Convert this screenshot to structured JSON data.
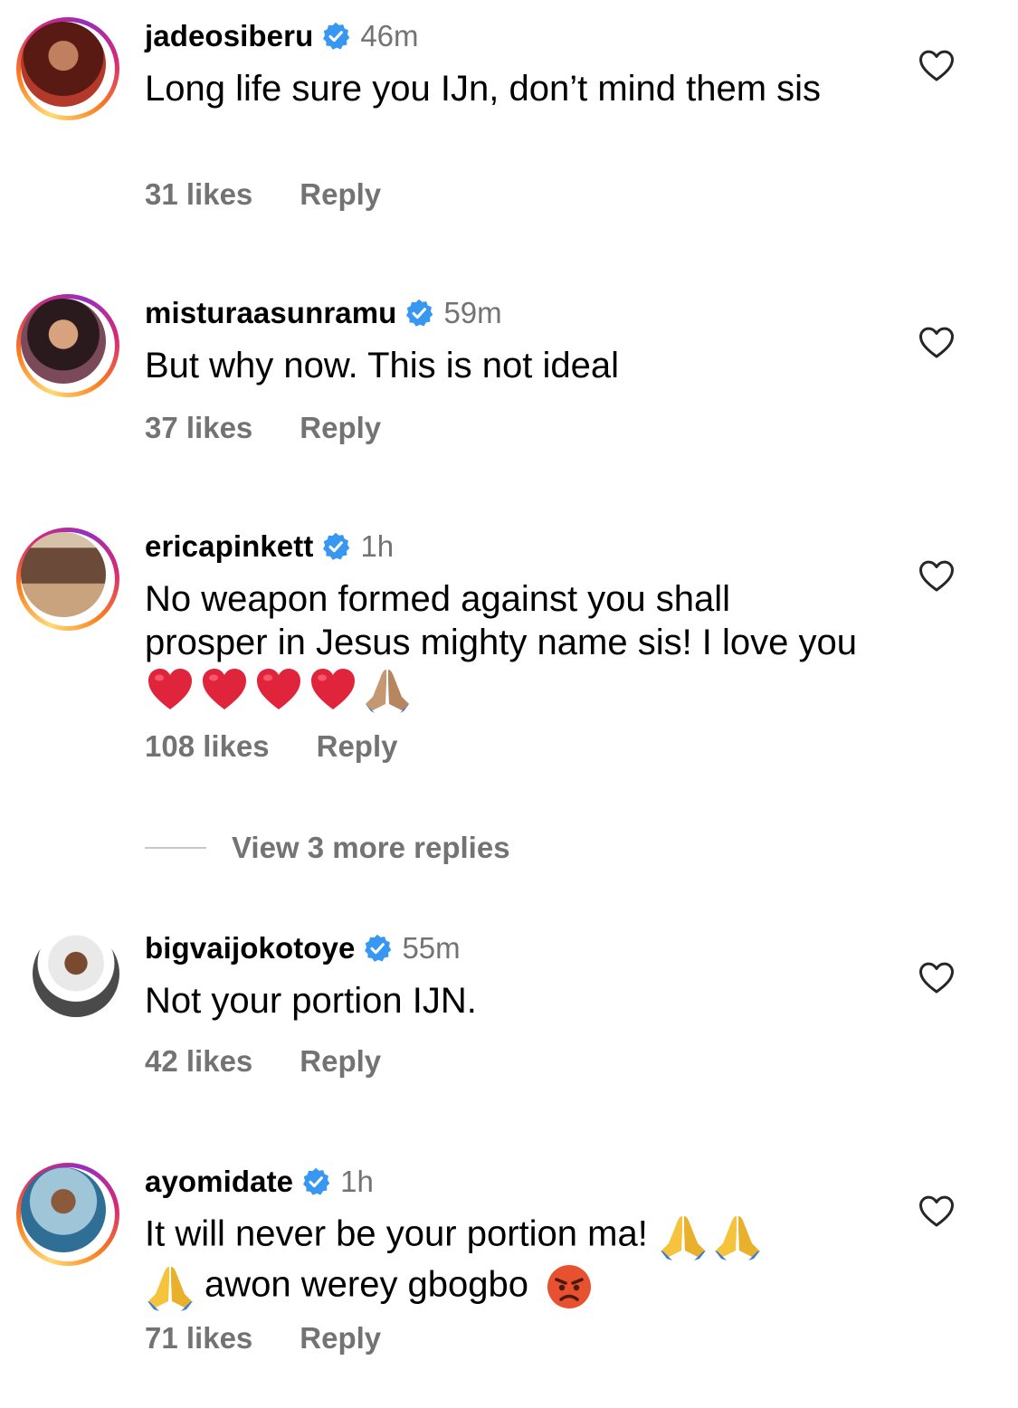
{
  "comments": [
    {
      "username": "jadeosiberu",
      "time": "46m",
      "text": "Long life sure you IJn, don’t mind them sis",
      "likes": "31 likes",
      "reply": "Reply",
      "avatar_colors": [
        "#5a1a14",
        "#b33a2a"
      ]
    },
    {
      "username": "misturaasunramu",
      "time": "59m",
      "text": "But why now. This is not ideal",
      "likes": "37 likes",
      "reply": "Reply",
      "avatar_colors": [
        "#2a1a1e",
        "#7a4a5a"
      ]
    },
    {
      "username": "ericapinkett",
      "time": "1h",
      "text": "No weapon formed against you shall prosper in Jesus mighty name sis! I love you",
      "likes": "108 likes",
      "reply": "Reply",
      "avatar_colors": [
        "#6b4a3a",
        "#c9a27e"
      ]
    },
    {
      "username": "bigvaijokotoye",
      "time": "55m",
      "text": "Not your portion IJN.",
      "likes": "42 likes",
      "reply": "Reply",
      "avatar_colors": [
        "#e9e9e9",
        "#4a4a4a"
      ]
    },
    {
      "username": "ayomidate",
      "time": "1h",
      "text_line1": "It will never be your portion ma!",
      "text_line2": "awon werey gbogbo",
      "likes": "71 likes",
      "reply": "Reply",
      "avatar_colors": [
        "#9fc6d8",
        "#2f6f95"
      ]
    }
  ],
  "view_more": "View 3 more replies",
  "icons": {
    "verified": "verified-badge-icon",
    "heart": "heart-outline-icon",
    "red_heart": "red-heart-emoji",
    "pray_tan": "folded-hands-medium-skin-emoji",
    "pray_yellow": "folded-hands-emoji",
    "angry": "angry-face-emoji"
  },
  "colors": {
    "verified_blue": "#3897f0",
    "secondary_text": "#737373",
    "heart_stroke": "#262626"
  }
}
